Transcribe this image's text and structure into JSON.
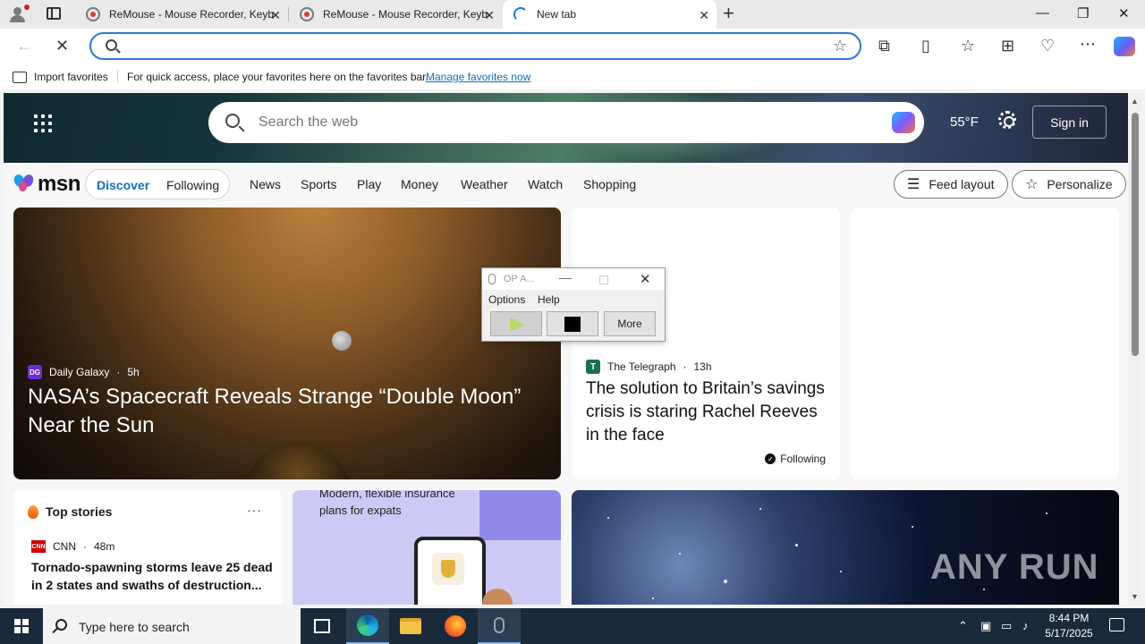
{
  "browser": {
    "tabs": [
      {
        "title": "ReMouse - Mouse Recorder, Keyb"
      },
      {
        "title": "ReMouse - Mouse Recorder, Keyb"
      },
      {
        "title": "New tab",
        "active": true
      }
    ],
    "address": {
      "value": "",
      "placeholder": ""
    },
    "favorites_bar": {
      "import_label": "Import favorites",
      "message": "For quick access, place your favorites here on the favorites bar.",
      "manage_link": "Manage favorites now"
    }
  },
  "msn": {
    "search_placeholder": "Search the web",
    "weather": "55°F",
    "sign_in": "Sign in",
    "logo_text": "msn",
    "feed_toggle": {
      "discover": "Discover",
      "following": "Following"
    },
    "nav": [
      "News",
      "Sports",
      "Play",
      "Money",
      "Weather",
      "Watch",
      "Shopping"
    ],
    "feed_layout": "Feed layout",
    "personalize": "Personalize",
    "feature": {
      "source": "Daily Galaxy",
      "source_logo": "DG",
      "age": "5h",
      "headline": "NASA’s Spacecraft Reveals Strange “Double Moon” Near the Sun"
    },
    "telegraph": {
      "source": "The Telegraph",
      "age": "13h",
      "headline": "The solution to Britain’s savings crisis is staring Rachel Reeves in the face",
      "following": "Following"
    },
    "top_stories": {
      "title": "Top stories",
      "source": "CNN",
      "source_logo": "CNN",
      "age": "48m",
      "headline": "Tornado-spawning storms leave 25 dead in 2 states and swaths of destruction..."
    },
    "ad": {
      "text": "Modern, flexible insurance plans for expats"
    },
    "watermark": "ANY RUN"
  },
  "op_window": {
    "title": "OP A...",
    "menu": [
      "Options",
      "Help"
    ],
    "more_button": "More"
  },
  "taskbar": {
    "search_placeholder": "Type here to search",
    "time": "8:44 PM",
    "date": "5/17/2025"
  },
  "colors": {
    "accent": "#0f6cbd",
    "address_border": "#2b78d4",
    "taskbar": "#1b2a3a"
  }
}
